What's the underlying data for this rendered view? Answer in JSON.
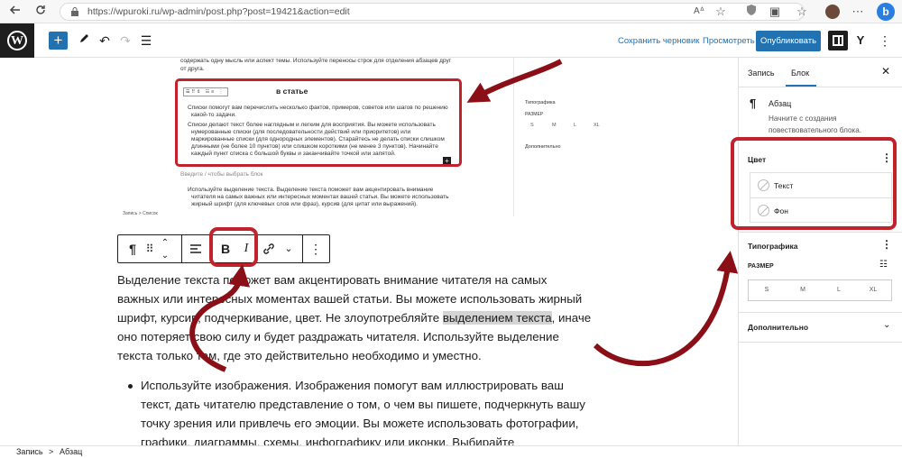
{
  "browser": {
    "url": "https://wpuroki.ru/wp-admin/post.php?post=19421&action=edit",
    "back_icon": "back-arrow-icon",
    "refresh_icon": "refresh-icon"
  },
  "header": {
    "save_draft": "Сохранить черновик",
    "preview": "Просмотреть",
    "publish": "Опубликовать"
  },
  "embedded": {
    "top_line": "содержать одну мысль или аспект темы. Используйте переносы строк для отделения абзацев друг",
    "top_line2": "от друга.",
    "heading": "в статье",
    "b1a": "Списки помогут вам перечислить несколько фактов, примеров, советов или шагов по решению",
    "b1b": "какой-то задачи.",
    "b2a": "Списки делают текст более наглядным и легким для восприятия. Вы можете использовать",
    "b2b": "нумерованные списки (для последовательности действий или приоритетов) или",
    "b2c": "маркированные списки (для однородных элементов). Старайтесь не делать списки слишком",
    "b2d": "длинными (не более 10 пунктов) или слишком короткими (не менее 3 пунктов). Начинайте",
    "b2e": "каждый пункт списка с большой буквы и заканчивайте точкой или запятой.",
    "hint": "Введите / чтобы выбрать блок",
    "b3a": "Используйте выделение текста. Выделение текста поможет вам акцентировать внимание",
    "b3b": "читателя на самых важных или интересных моментах вашей статьи. Вы можете использовать",
    "b3c": "жирный шрифт (для ключевых слов или фраз), курсив (для цитат или выражений).",
    "crumb": "Запись  >  Список",
    "side_typo": "Типографика",
    "side_size": "РАЗМЕР",
    "side_sizes": [
      "S",
      "M",
      "L",
      "XL"
    ],
    "side_adv": "Дополнительно"
  },
  "toolbar": {
    "paragraph_icon": "¶",
    "bold": "B",
    "italic": "I"
  },
  "content": {
    "p_before": "Выделение текста поможет вам акцентировать внимание читателя на самых важных или интересных моментах вашей статьи. Вы можете использовать жирный шрифт, курсив, подчеркивание, цвет. Не злоупотребляйте ",
    "p_selected": "выделением текста",
    "p_after": ", иначе оно потеряет свою силу и будет раздражать читателя. Используйте выделение текста только там, где это действительно необходимо и уместно.",
    "bullet": "Используйте изображения. Изображения помогут вам иллюстрировать ваш текст, дать читателю представление о том, о чем вы пишете, подчеркнуть вашу точку зрения или привлечь его эмоции. Вы можете использовать фотографии, графики, диаграммы, схемы, инфографику или иконки. Выбирайте качественные и релевантные изображения, которые"
  },
  "sidebar": {
    "tab_post": "Запись",
    "tab_block": "Блок",
    "block_title": "Абзац",
    "block_desc": "Начните с создания повествовательного блока.",
    "color_title": "Цвет",
    "color_text": "Текст",
    "color_bg": "Фон",
    "typo_title": "Типографика",
    "size_label": "РАЗМЕР",
    "sizes": [
      "S",
      "M",
      "L",
      "XL"
    ],
    "advanced": "Дополнительно"
  },
  "footer": {
    "crumb1": "Запись",
    "crumb2": "Абзац"
  },
  "colors": {
    "accent": "#2271b1",
    "highlight": "#c0232c"
  }
}
